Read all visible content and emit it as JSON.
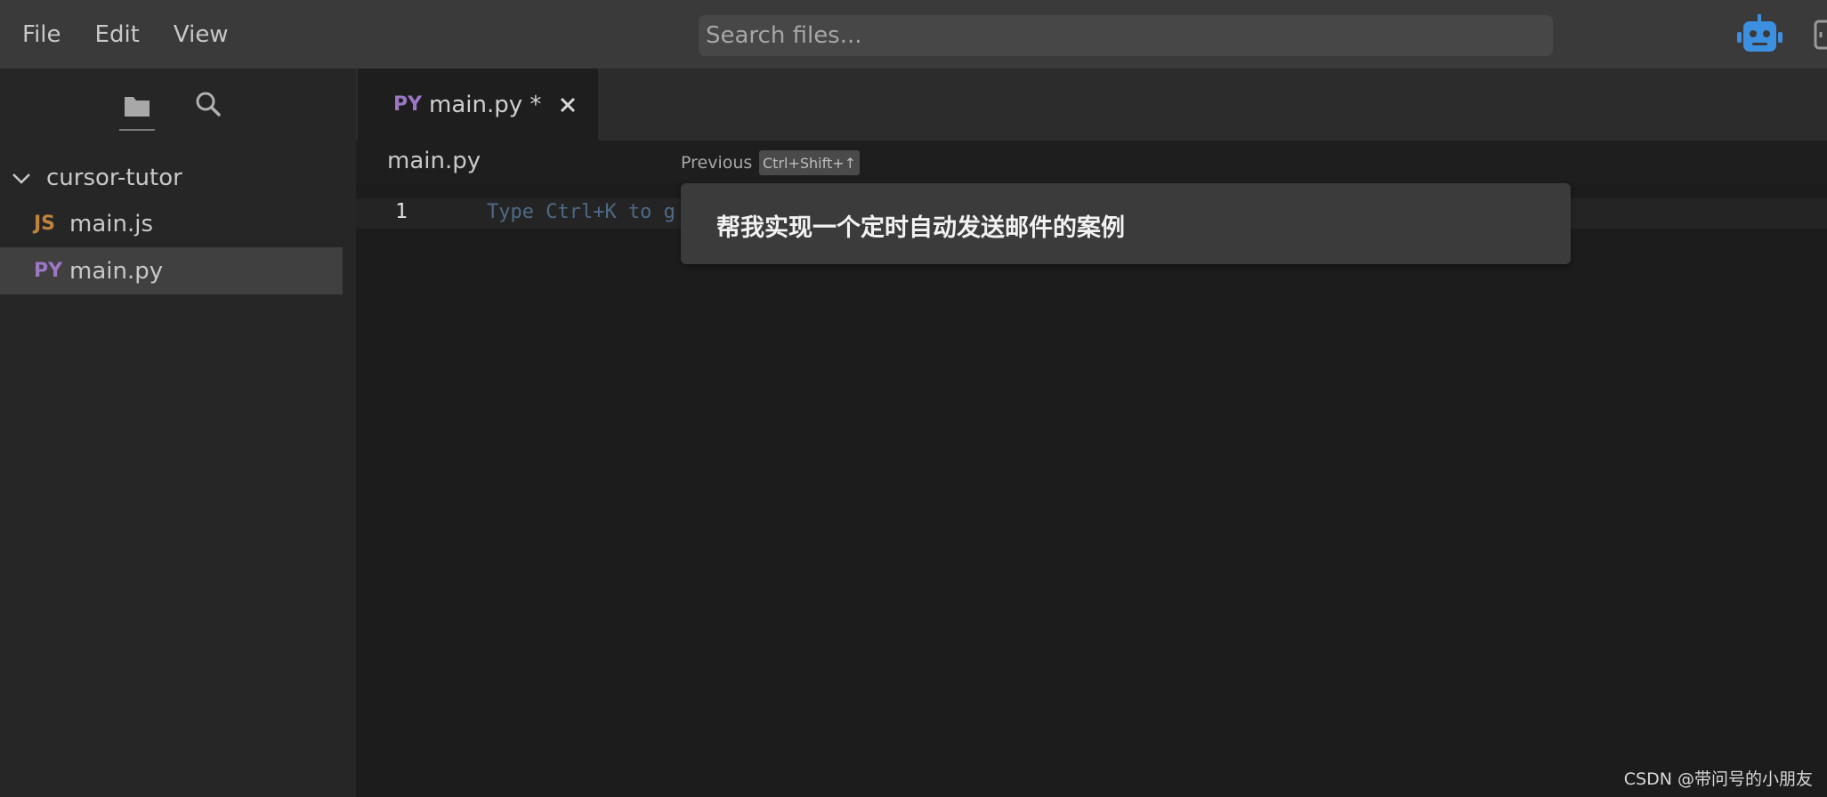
{
  "menu": {
    "file": "File",
    "edit": "Edit",
    "view": "View"
  },
  "search": {
    "placeholder": "Search files..."
  },
  "sidebar": {
    "folder": "cursor-tutor",
    "files": [
      {
        "badge": "JS",
        "name": "main.js"
      },
      {
        "badge": "PY",
        "name": "main.py"
      }
    ]
  },
  "editor": {
    "tab": {
      "badge": "PY",
      "label": "main.py *"
    },
    "breadcrumb": "main.py",
    "previous_label": "Previous",
    "previous_shortcut": "Ctrl+Shift+↑",
    "line_number": "1",
    "ghost_text": "Type Ctrl+K to g",
    "prompt": "帮我实现一个定时自动发送邮件的案例"
  },
  "watermark": "CSDN @带问号的小朋友",
  "colors": {
    "js_badge": "#c0833c",
    "py_badge": "#9d76c4",
    "bot_icon": "#3d8fe0"
  }
}
